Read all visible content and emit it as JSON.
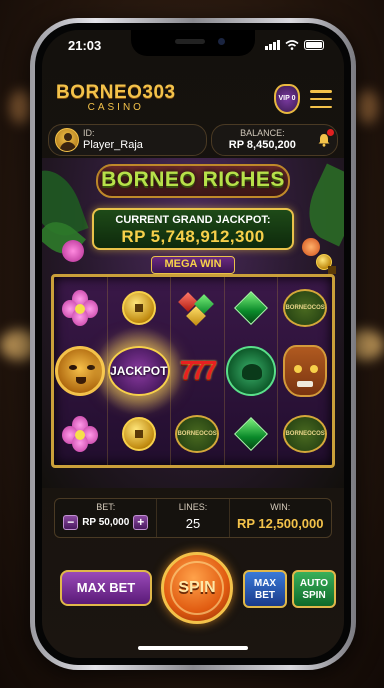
{
  "status": {
    "time": "21:03"
  },
  "brand": {
    "name": "BORNEO303",
    "subtitle": "CASINO",
    "vip_level": "VIP 0"
  },
  "player": {
    "id_label": "ID:",
    "id_value": "Player_Raja"
  },
  "balance": {
    "label": "BALANCE:",
    "value": "RP 8,450,200"
  },
  "game": {
    "title": "BORNEO RICHES",
    "jackpot_label": "CURRENT GRAND JACKPOT:",
    "jackpot_value": "RP 5,748,912,300",
    "banner": "MEGA WIN"
  },
  "reels": {
    "rows": [
      [
        "orchid",
        "gold-coin",
        "gems",
        "emerald",
        "scatter"
      ],
      [
        "tiger",
        "jackpot",
        "sevens",
        "dragon",
        "tribal-mask"
      ],
      [
        "orchid",
        "gold-coin",
        "scatter",
        "emerald",
        "scatter"
      ]
    ],
    "jackpot_symbol_text": "JACKPOT",
    "sevens_text": "777",
    "scatter_text_top": "BORNEOCOS",
    "scatter_text_bottom": "BORNEOCOS"
  },
  "controls": {
    "bet_label": "BET:",
    "bet_value": "RP 50,000",
    "minus": "−",
    "plus": "+",
    "lines_label": "LINES:",
    "lines_value": "25",
    "win_label": "WIN:",
    "win_value": "RP 12,500,000"
  },
  "buttons": {
    "max_bet": "MAX BET",
    "spin": "SPIN",
    "max_bet_small": "MAX BET",
    "auto_spin": "AUTO SPIN"
  }
}
